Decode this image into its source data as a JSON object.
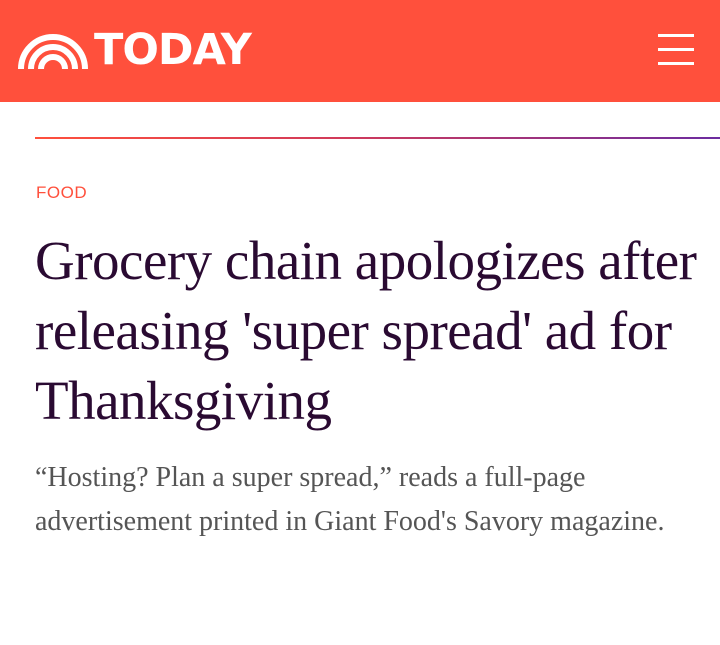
{
  "header": {
    "logo_text": "TODAY",
    "background_color": "#ff503c",
    "menu_icon": "hamburger-menu-icon"
  },
  "article": {
    "category": "FOOD",
    "headline": "Grocery chain apologizes after releasing 'super spread' ad for Thanksgiving",
    "dek": "“Hosting? Plan a super spread,” reads a full-page advertisement printed in Giant Food's Savory magazine."
  },
  "colors": {
    "accent": "#ff503c",
    "headline": "#2a0a32",
    "dek": "#555555"
  }
}
